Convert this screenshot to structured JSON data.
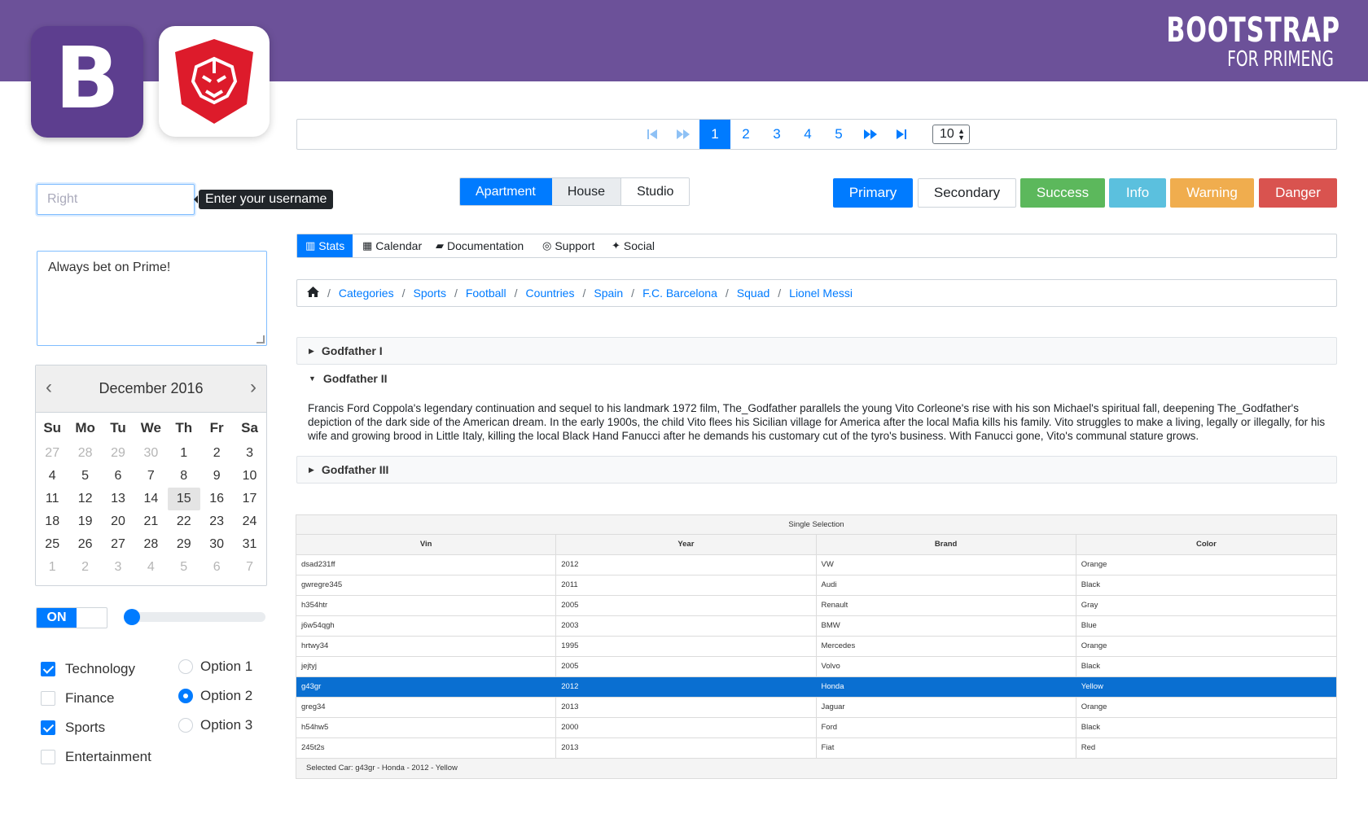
{
  "brand": {
    "title": "BOOTSTRAP",
    "subtitle": "FOR PRIMENG",
    "bootstrap_letter": "B"
  },
  "paginator": {
    "first_icon": "step-backward-icon",
    "prev_icon": "fast-backward-icon",
    "pages": [
      "1",
      "2",
      "3",
      "4",
      "5"
    ],
    "active_page": "1",
    "next_icon": "fast-forward-icon",
    "last_icon": "step-forward-icon",
    "rows_per_page": "10"
  },
  "username": {
    "value": "Right",
    "tooltip": "Enter your username"
  },
  "textarea": {
    "value": "Always bet on Prime!"
  },
  "calendar": {
    "month_label": "December 2016",
    "day_headers": [
      "Su",
      "Mo",
      "Tu",
      "We",
      "Th",
      "Fr",
      "Sa"
    ],
    "weeks": [
      [
        "27",
        "28",
        "29",
        "30",
        "1",
        "2",
        "3"
      ],
      [
        "4",
        "5",
        "6",
        "7",
        "8",
        "9",
        "10"
      ],
      [
        "11",
        "12",
        "13",
        "14",
        "15",
        "16",
        "17"
      ],
      [
        "18",
        "19",
        "20",
        "21",
        "22",
        "23",
        "24"
      ],
      [
        "25",
        "26",
        "27",
        "28",
        "29",
        "30",
        "31"
      ],
      [
        "1",
        "2",
        "3",
        "4",
        "5",
        "6",
        "7"
      ]
    ],
    "today": "15"
  },
  "toggle": {
    "label": "ON",
    "checked": true
  },
  "slider": {
    "value": 0
  },
  "checkboxes": [
    {
      "label": "Technology",
      "checked": true
    },
    {
      "label": "Finance",
      "checked": false
    },
    {
      "label": "Sports",
      "checked": true
    },
    {
      "label": "Entertainment",
      "checked": false
    }
  ],
  "radios": [
    {
      "label": "Option 1",
      "checked": false
    },
    {
      "label": "Option 2",
      "checked": true
    },
    {
      "label": "Option 3",
      "checked": false
    }
  ],
  "select_button": {
    "options": [
      "Apartment",
      "House",
      "Studio"
    ],
    "selected": "Apartment"
  },
  "buttons": [
    {
      "label": "Primary",
      "color": "#007bff"
    },
    {
      "label": "Secondary",
      "color": "#ffffff"
    },
    {
      "label": "Success",
      "color": "#5cb85c"
    },
    {
      "label": "Info",
      "color": "#5bc0de"
    },
    {
      "label": "Warning",
      "color": "#f0ad4e"
    },
    {
      "label": "Danger",
      "color": "#d9534f"
    }
  ],
  "tabmenu": [
    {
      "label": "Stats",
      "icon": "bar-chart-icon",
      "active": true
    },
    {
      "label": "Calendar",
      "icon": "calendar-icon"
    },
    {
      "label": "Documentation",
      "icon": "book-icon"
    },
    {
      "label": "Support",
      "icon": "life-ring-icon"
    },
    {
      "label": "Social",
      "icon": "twitter-icon"
    }
  ],
  "breadcrumb": {
    "home_icon": "home-icon",
    "items": [
      "Categories",
      "Sports",
      "Football",
      "Countries",
      "Spain",
      "F.C. Barcelona",
      "Squad",
      "Lionel Messi"
    ]
  },
  "accordion": [
    {
      "header": "Godfather I",
      "open": false
    },
    {
      "header": "Godfather II",
      "open": true,
      "content": "Francis Ford Coppola's legendary continuation and sequel to his landmark 1972 film, The_Godfather parallels the young Vito Corleone's rise with his son Michael's spiritual fall, deepening The_Godfather's depiction of the dark side of the American dream. In the early 1900s, the child Vito flees his Sicilian village for America after the local Mafia kills his family. Vito struggles to make a living, legally or illegally, for his wife and growing brood in Little Italy, killing the local Black Hand Fanucci after he demands his customary cut of the tyro's business. With Fanucci gone, Vito's communal stature grows."
    },
    {
      "header": "Godfather III",
      "open": false
    }
  ],
  "table": {
    "caption": "Single Selection",
    "columns": [
      "Vin",
      "Year",
      "Brand",
      "Color"
    ],
    "rows": [
      [
        "dsad231ff",
        "2012",
        "VW",
        "Orange"
      ],
      [
        "gwregre345",
        "2011",
        "Audi",
        "Black"
      ],
      [
        "h354htr",
        "2005",
        "Renault",
        "Gray"
      ],
      [
        "j6w54qgh",
        "2003",
        "BMW",
        "Blue"
      ],
      [
        "hrtwy34",
        "1995",
        "Mercedes",
        "Orange"
      ],
      [
        "jejtyj",
        "2005",
        "Volvo",
        "Black"
      ],
      [
        "g43gr",
        "2012",
        "Honda",
        "Yellow"
      ],
      [
        "greg34",
        "2013",
        "Jaguar",
        "Orange"
      ],
      [
        "h54hw5",
        "2000",
        "Ford",
        "Black"
      ],
      [
        "245t2s",
        "2013",
        "Fiat",
        "Red"
      ]
    ],
    "selected_row": 6,
    "footer": "Selected Car: g43gr - Honda - 2012 - Yellow"
  }
}
